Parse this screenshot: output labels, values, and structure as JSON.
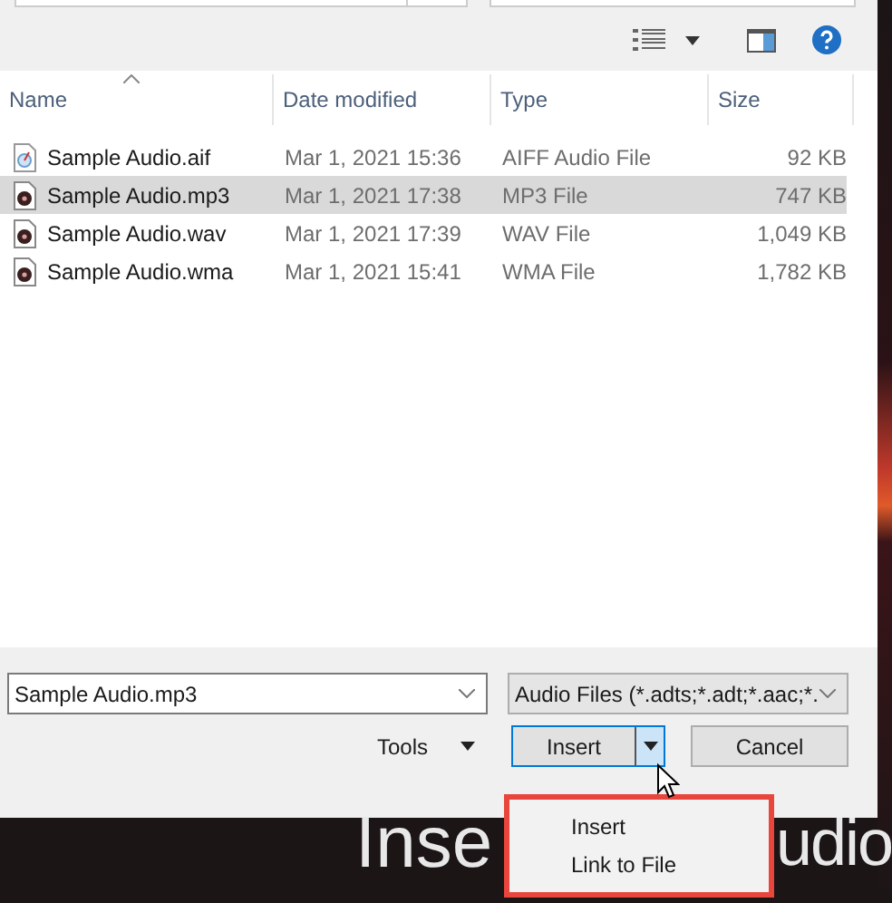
{
  "columns": [
    {
      "label": "Name",
      "sorted": true
    },
    {
      "label": "Date modified",
      "sorted": false
    },
    {
      "label": "Type",
      "sorted": false
    },
    {
      "label": "Size",
      "sorted": false
    }
  ],
  "files": [
    {
      "name": "Sample Audio.aif",
      "date": "Mar 1, 2021 15:36",
      "type": "AIFF Audio File",
      "size": "92 KB",
      "kind": "aiff",
      "selected": false
    },
    {
      "name": "Sample Audio.mp3",
      "date": "Mar 1, 2021 17:38",
      "type": "MP3 File",
      "size": "747 KB",
      "kind": "media",
      "selected": true
    },
    {
      "name": "Sample Audio.wav",
      "date": "Mar 1, 2021 17:39",
      "type": "WAV File",
      "size": "1,049 KB",
      "kind": "media",
      "selected": false
    },
    {
      "name": "Sample Audio.wma",
      "date": "Mar 1, 2021 15:41",
      "type": "WMA File",
      "size": "1,782 KB",
      "kind": "media",
      "selected": false
    }
  ],
  "file_name": {
    "value": "Sample Audio.mp3"
  },
  "file_type": {
    "value": "Audio Files (*.adts;*.adt;*.aac;*."
  },
  "buttons": {
    "tools": "Tools",
    "insert": "Insert",
    "cancel": "Cancel"
  },
  "menu": {
    "items": [
      {
        "label": "Insert"
      },
      {
        "label": "Link to File"
      }
    ]
  },
  "background_text": [
    "Inse",
    "udio"
  ]
}
